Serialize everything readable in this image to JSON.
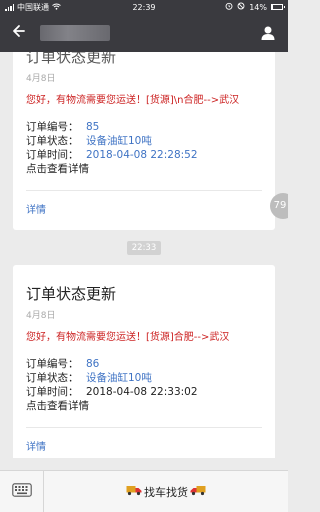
{
  "status_bar": {
    "carrier": "中国联通",
    "time": "22:39",
    "battery_text": "14%",
    "battery_level": 0.14
  },
  "nav": {
    "back_icon": "arrow-left-icon",
    "user_icon": "person-icon"
  },
  "messages": [
    {
      "title": "订单状态更新",
      "date": "4月8日",
      "message": "您好，有物流需要您运送！[货源]\\n合肥-->武汉",
      "fields": [
        {
          "label": "订单编号：",
          "value": "85"
        },
        {
          "label": "订单状态：",
          "value": "设备油缸10吨"
        },
        {
          "label": "订单时间：",
          "value": "2018-04-08 22:28:52"
        }
      ],
      "link": "点击查看详情",
      "detail": "详情"
    },
    {
      "title": "订单状态更新",
      "date": "4月8日",
      "message": "您好，有物流需要您运送！[货源]合肥-->武汉",
      "fields": [
        {
          "label": "订单编号：",
          "value": "86"
        },
        {
          "label": "订单状态：",
          "value": "设备油缸10吨"
        },
        {
          "label": "订单时间：",
          "value": "2018-04-08 22:33:02"
        }
      ],
      "link": "点击查看详情",
      "detail": "详情"
    }
  ],
  "time_divider": "22:33",
  "unread_count": "79",
  "bottom_bar": {
    "keyboard_icon": "keyboard-icon",
    "menu_label": "找车找货",
    "menu_icon": "truck-icon"
  },
  "colors": {
    "header_bg": "#3a3a3f",
    "message_red": "#cc2222",
    "link_blue": "#3f73c4",
    "page_bg": "#ebebeb"
  }
}
